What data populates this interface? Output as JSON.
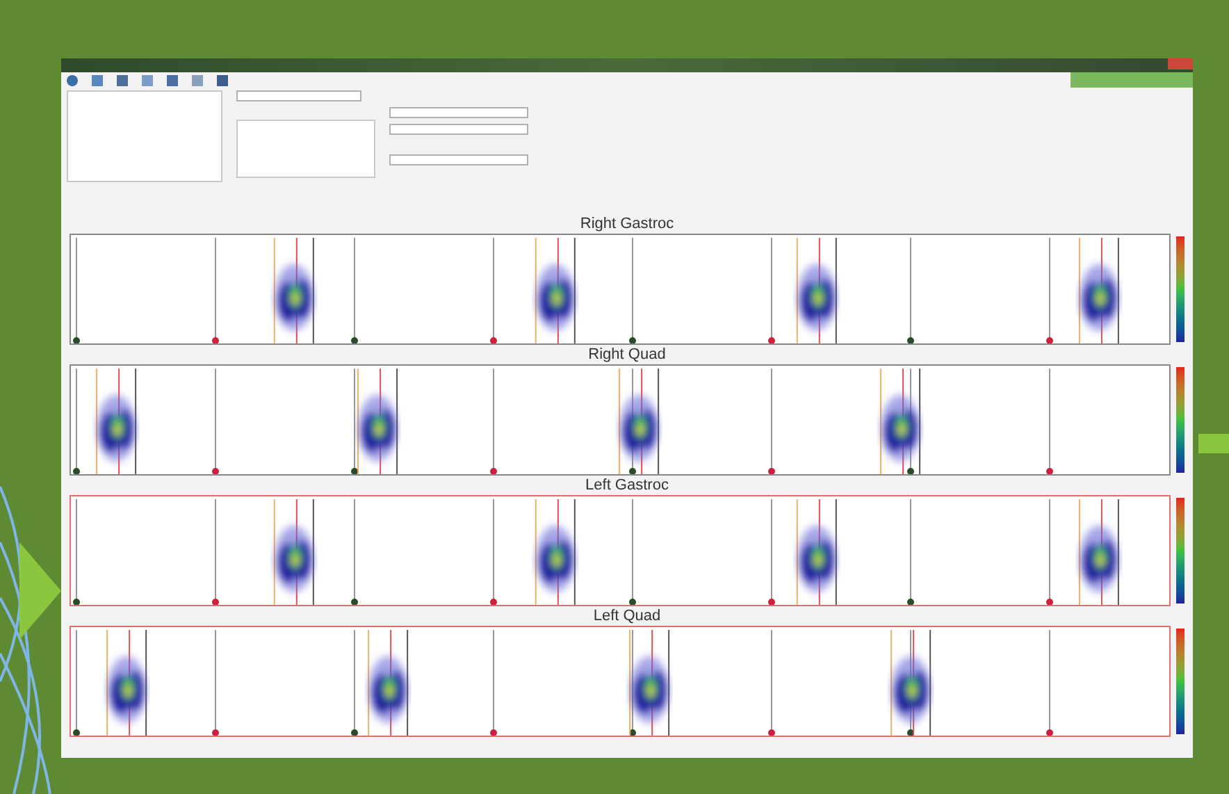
{
  "charts": [
    {
      "title": "Right Gastroc"
    },
    {
      "title": "Right Quad"
    },
    {
      "title": "Left Gastroc"
    },
    {
      "title": "Left Quad"
    }
  ]
}
